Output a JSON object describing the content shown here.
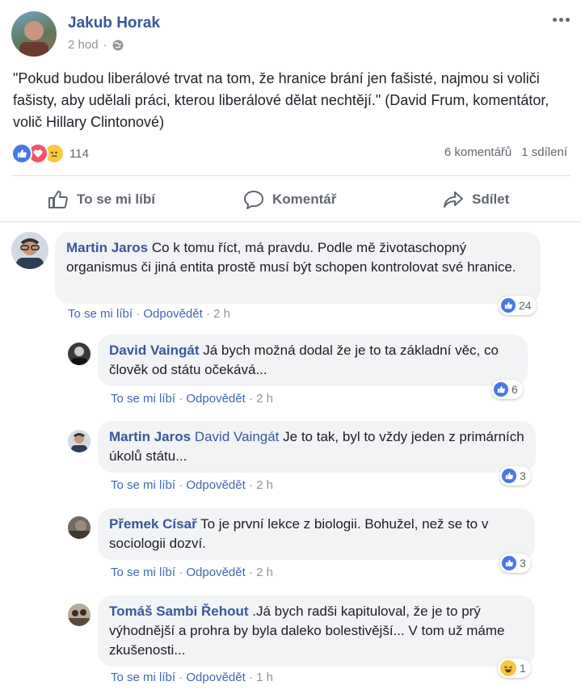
{
  "post": {
    "author": "Jakub Horak",
    "time": "2 hod",
    "privacy_sep": "·",
    "text": "\"Pokud budou liberálové trvat na tom, že hranice brání jen fašisté, najmou si voliči fašisty, aby udělali práci, kterou liberálové dělat nechtějí.\" (David Frum, komentátor, volič Hillary Clintonové)",
    "reaction_count": "114",
    "comments_count": "6 komentářů",
    "shares_count": "1 sdílení"
  },
  "actions": {
    "like": "To se mi líbí",
    "comment": "Komentář",
    "share": "Sdílet"
  },
  "comments": [
    {
      "author": "Martin Jaros",
      "mention": "",
      "text": "Co k tomu říct, má pravdu. Podle mě životaschopný organismus či jiná entita prostě musí být schopen kontrolovat své hranice.",
      "like": "To se mi líbí",
      "reply": "Odpovědět",
      "time": "2 h",
      "reactions": "24"
    },
    {
      "author": "David Vaingát",
      "mention": "",
      "text": "Já bych možná dodal že je to ta základní věc, co člověk od státu očekává...",
      "like": "To se mi líbí",
      "reply": "Odpovědět",
      "time": "2 h",
      "reactions": "6"
    },
    {
      "author": "Martin Jaros",
      "mention": "David Vaingát",
      "text": "Je to tak, byl to vždy jeden z primárních úkolů státu...",
      "like": "To se mi líbí",
      "reply": "Odpovědět",
      "time": "2 h",
      "reactions": "3"
    },
    {
      "author": "Přemek Císař",
      "mention": "",
      "text": "To je první lekce z biologii. Bohužel, než se to v sociologii dozví.",
      "like": "To se mi líbí",
      "reply": "Odpovědět",
      "time": "2 h",
      "reactions": "3"
    },
    {
      "author": "Tomáš Sambi Řehout",
      "mention": "",
      "text": ".Já bych radši kapituloval, že je to prý výhodnější a prohra by byla daleko bolestivější... V tom už máme zkušenosti...",
      "like": "To se mi líbí",
      "reply": "Odpovědět",
      "time": "1 h",
      "reactions": "1"
    }
  ],
  "colors": {
    "link": "#385898",
    "like_blue": "#4a76e8",
    "bubble": "#f2f3f5",
    "meta": "#90949c"
  }
}
